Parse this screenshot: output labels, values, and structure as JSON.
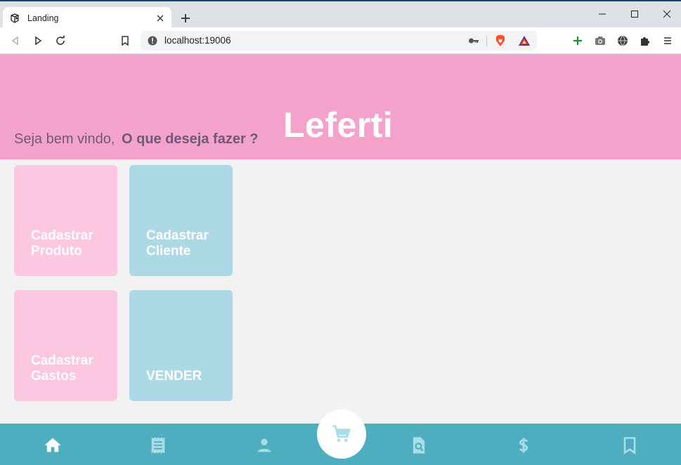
{
  "browser": {
    "tab_title": "Landing",
    "url": "localhost:19006"
  },
  "page": {
    "greeting": "Seja bem vindo,",
    "question": "O que deseja fazer ?",
    "brand": "Leferti",
    "cards": [
      {
        "line1": "Cadastrar",
        "line2": "Produto",
        "color": "#fcc7e1"
      },
      {
        "line1": "Cadastrar",
        "line2": "Cliente",
        "color": "#add8e6"
      },
      {
        "line1": "Cadastrar",
        "line2": "Gastos",
        "color": "#fcc7e1"
      },
      {
        "line1": "",
        "line2": "VENDER",
        "color": "#add8e6"
      }
    ]
  },
  "bottom_nav": {
    "items": [
      "home-icon",
      "receipt-icon",
      "person-icon",
      "cart-icon",
      "search-document-icon",
      "dollar-icon",
      "bookmark-icon"
    ]
  },
  "colors": {
    "hero": "#f4a2cc",
    "bottom_bar": "#4fadc0",
    "active_icon": "#ffffff",
    "inactive_icon": "#a9dde7"
  }
}
